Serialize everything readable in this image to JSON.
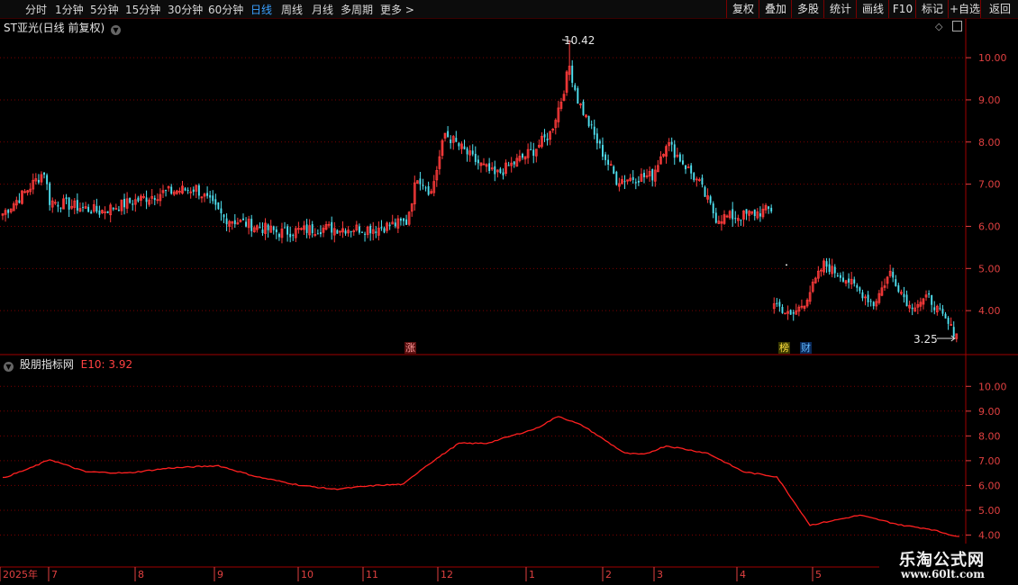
{
  "toolbar": {
    "periods": [
      "分时",
      "1分钟",
      "5分钟",
      "15分钟",
      "30分钟",
      "60分钟",
      "日线",
      "周线",
      "月线",
      "多周期",
      "更多 >"
    ],
    "active_period": "日线",
    "buttons": [
      "复权",
      "叠加",
      "多股",
      "统计",
      "画线",
      "F10",
      "标记",
      "+自选",
      "返回"
    ]
  },
  "main_chart": {
    "title": "ST亚光(日线 前复权)",
    "high_label": "10.42",
    "low_label": "3.25",
    "tags": {
      "zhang": "涨",
      "bang": "榜",
      "cai": "财"
    }
  },
  "indicator": {
    "name": "股朋指标网",
    "value_label": "E10: 3.92"
  },
  "colors": {
    "up": "#ff3b3b",
    "down": "#4fe0f0",
    "line": "#ff2020",
    "grid": "#7a0000",
    "axis": "#e04040"
  },
  "chart_data": [
    {
      "type": "candlestick",
      "title": "ST亚光(日线 前复权)",
      "ylim": [
        3.0,
        10.6
      ],
      "y_ticks": [
        4.0,
        5.0,
        6.0,
        7.0,
        8.0,
        9.0,
        10.0
      ],
      "x_month_labels": [
        "2025年",
        "7",
        "8",
        "9",
        "10",
        "11",
        "12",
        "1",
        "2",
        "3",
        "4",
        "5"
      ],
      "anchors_close": [
        [
          0,
          6.3
        ],
        [
          8,
          6.8
        ],
        [
          15,
          7.3
        ],
        [
          17,
          6.6
        ],
        [
          35,
          6.35
        ],
        [
          58,
          6.8
        ],
        [
          70,
          6.9
        ],
        [
          80,
          6.2
        ],
        [
          100,
          5.85
        ],
        [
          115,
          5.95
        ],
        [
          135,
          5.95
        ],
        [
          146,
          6.1
        ],
        [
          150,
          7.2
        ],
        [
          155,
          6.8
        ],
        [
          160,
          8.2
        ],
        [
          170,
          7.6
        ],
        [
          178,
          7.2
        ],
        [
          185,
          7.5
        ],
        [
          192,
          7.8
        ],
        [
          198,
          8.2
        ],
        [
          202,
          9.0
        ],
        [
          205,
          9.8
        ],
        [
          208,
          9.0
        ],
        [
          215,
          8.0
        ],
        [
          222,
          7.1
        ],
        [
          235,
          7.2
        ],
        [
          240,
          8.0
        ],
        [
          245,
          7.6
        ],
        [
          252,
          7.0
        ],
        [
          258,
          6.2
        ],
        [
          268,
          6.25
        ],
        [
          275,
          6.35
        ],
        [
          278,
          6.4
        ]
      ],
      "gap_after_index": 278,
      "anchors_close_after_gap": [
        [
          279,
          4.2
        ],
        [
          285,
          3.85
        ],
        [
          290,
          4.2
        ],
        [
          297,
          5.1
        ],
        [
          306,
          4.7
        ],
        [
          315,
          4.15
        ],
        [
          321,
          4.9
        ],
        [
          328,
          4.1
        ],
        [
          335,
          4.3
        ],
        [
          340,
          3.85
        ],
        [
          345,
          3.4
        ]
      ],
      "high": 10.42,
      "low": 3.25
    },
    {
      "type": "line",
      "title": "股朋指标网",
      "series_name": "E10",
      "last_value": 3.92,
      "ylim": [
        3.8,
        10.7
      ],
      "y_ticks": [
        4.0,
        5.0,
        6.0,
        7.0,
        8.0,
        9.0,
        10.0
      ],
      "anchors": [
        [
          0,
          6.3
        ],
        [
          10,
          6.7
        ],
        [
          17,
          7.05
        ],
        [
          30,
          6.55
        ],
        [
          45,
          6.5
        ],
        [
          60,
          6.7
        ],
        [
          78,
          6.8
        ],
        [
          92,
          6.35
        ],
        [
          108,
          6.0
        ],
        [
          120,
          5.85
        ],
        [
          135,
          6.0
        ],
        [
          145,
          6.05
        ],
        [
          152,
          6.7
        ],
        [
          165,
          7.7
        ],
        [
          175,
          7.7
        ],
        [
          193,
          8.3
        ],
        [
          201,
          8.8
        ],
        [
          210,
          8.4
        ],
        [
          225,
          7.3
        ],
        [
          232,
          7.25
        ],
        [
          240,
          7.6
        ],
        [
          255,
          7.3
        ],
        [
          268,
          6.55
        ],
        [
          280,
          6.35
        ],
        [
          292,
          4.4
        ],
        [
          310,
          4.8
        ],
        [
          325,
          4.4
        ],
        [
          335,
          4.25
        ],
        [
          346,
          3.92
        ]
      ]
    }
  ]
}
